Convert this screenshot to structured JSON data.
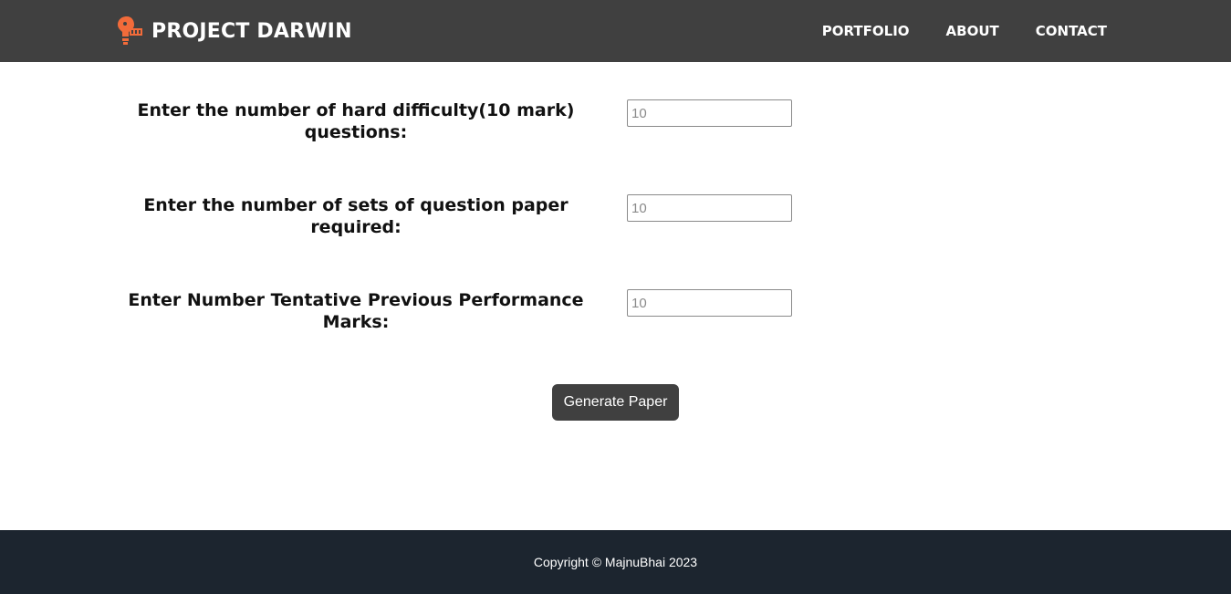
{
  "header": {
    "brand_name": "PROJECT DARWIN",
    "logo_icon": "lightbulb-logo-icon",
    "nav": [
      {
        "label": "PORTFOLIO"
      },
      {
        "label": "ABOUT"
      },
      {
        "label": "CONTACT"
      }
    ]
  },
  "form": {
    "fields": [
      {
        "label": "Enter the number of hard difficulty(10 mark) questions:",
        "placeholder": "10",
        "value": ""
      },
      {
        "label": "Enter the number of sets of question paper required:",
        "placeholder": "10",
        "value": ""
      },
      {
        "label": "Enter Number Tentative Previous Performance Marks:",
        "placeholder": "10",
        "value": ""
      }
    ],
    "submit_label": "Generate Paper"
  },
  "footer": {
    "copyright": "Copyright © MajnuBhai 2023"
  },
  "colors": {
    "navbar": "#404040",
    "footer": "#1c252f",
    "button": "#404040",
    "logo_accent": "#f26b3a"
  }
}
